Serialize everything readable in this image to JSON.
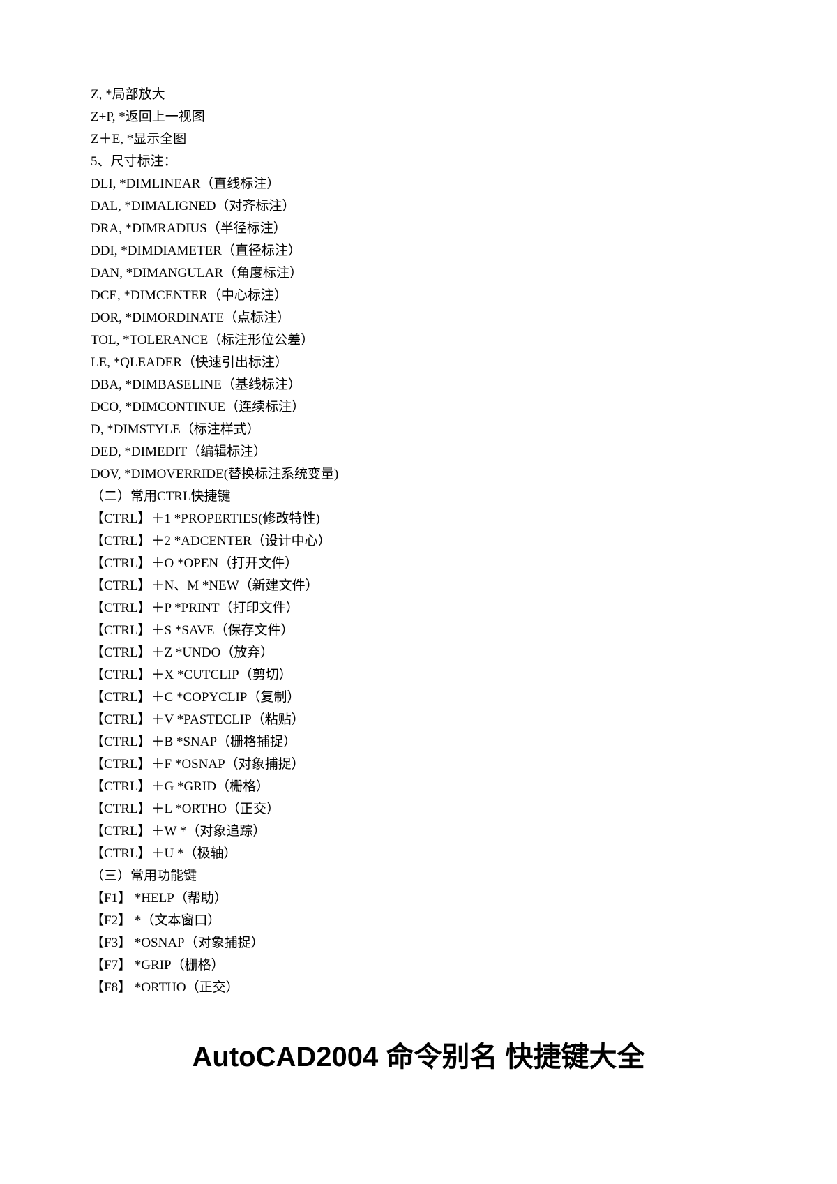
{
  "lines": [
    "Z, *局部放大",
    "Z+P, *返回上一视图",
    "Z＋E, *显示全图",
    "5、尺寸标注：",
    "DLI, *DIMLINEAR（直线标注）",
    "DAL, *DIMALIGNED（对齐标注）",
    "DRA, *DIMRADIUS（半径标注）",
    "DDI, *DIMDIAMETER（直径标注）",
    "DAN, *DIMANGULAR（角度标注）",
    "DCE, *DIMCENTER（中心标注）",
    "DOR, *DIMORDINATE（点标注）",
    "TOL, *TOLERANCE（标注形位公差）",
    "LE, *QLEADER（快速引出标注）",
    "DBA, *DIMBASELINE（基线标注）",
    "DCO, *DIMCONTINUE（连续标注）",
    "D, *DIMSTYLE（标注样式）",
    "DED, *DIMEDIT（编辑标注）",
    "DOV, *DIMOVERRIDE(替换标注系统变量)",
    "（二）常用CTRL快捷键",
    "【CTRL】＋1 *PROPERTIES(修改特性)",
    "【CTRL】＋2 *ADCENTER（设计中心）",
    "【CTRL】＋O *OPEN（打开文件）",
    "【CTRL】＋N、M *NEW（新建文件）",
    "【CTRL】＋P *PRINT（打印文件）",
    "【CTRL】＋S *SAVE（保存文件）",
    "【CTRL】＋Z *UNDO（放弃）",
    "【CTRL】＋X *CUTCLIP（剪切）",
    "【CTRL】＋C *COPYCLIP（复制）",
    "【CTRL】＋V *PASTECLIP（粘贴）",
    "【CTRL】＋B *SNAP（栅格捕捉）",
    "【CTRL】＋F *OSNAP（对象捕捉）",
    "【CTRL】＋G *GRID（栅格）",
    "【CTRL】＋L *ORTHO（正交）",
    "【CTRL】＋W *（对象追踪）",
    "【CTRL】＋U *（极轴）",
    "（三）常用功能键",
    "【F1】 *HELP（帮助）",
    "【F2】 *（文本窗口）",
    "【F3】 *OSNAP（对象捕捉）",
    "【F7】 *GRIP（栅格）",
    "【F8】 *ORTHO（正交）"
  ],
  "title": "AutoCAD2004 命令别名 快捷键大全"
}
